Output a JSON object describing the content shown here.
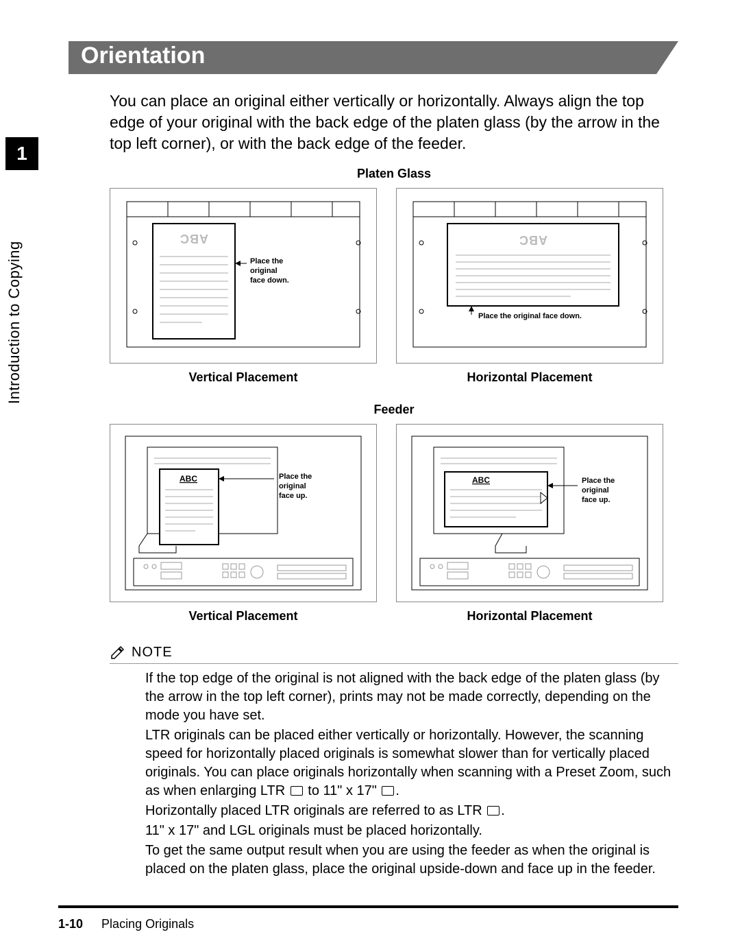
{
  "sidebar": {
    "chapter_number": "1",
    "chapter_label": "Introduction to Copying"
  },
  "heading": "Orientation",
  "intro_text": "You can place an original either vertically or horizontally. Always align the top edge of your original with the back edge of the platen glass (by the arrow in the top left corner), or with the back edge of the feeder.",
  "figures": {
    "platen": {
      "title": "Platen Glass",
      "vertical": {
        "caption": "Vertical Placement",
        "instruction": "Place the original face down.",
        "doc_text": "ABC"
      },
      "horizontal": {
        "caption": "Horizontal Placement",
        "instruction": "Place the original face down.",
        "doc_text": "ABC"
      }
    },
    "feeder": {
      "title": "Feeder",
      "vertical": {
        "caption": "Vertical Placement",
        "instruction": "Place the original face up.",
        "doc_text": "ABC"
      },
      "horizontal": {
        "caption": "Horizontal Placement",
        "instruction": "Place the original face up.",
        "doc_text": "ABC"
      }
    }
  },
  "note": {
    "heading": "NOTE",
    "paragraphs": [
      "If the top edge of the original is not aligned with the back edge of the platen glass (by the arrow in the top left corner), prints may not be made correctly, depending on the mode you have set.",
      "LTR originals can be placed either vertically or horizontally. However, the scanning speed for horizontally placed originals is somewhat slower than for vertically placed originals. You can place originals horizontally when scanning with a Preset Zoom, such as when enlarging LTR ⌷ to 11\" x 17\" ⌷.",
      "Horizontally placed LTR originals are referred to as LTR ⌷.",
      "11\" x 17\" and LGL originals must be placed horizontally.",
      "To get the same output result when you are using the feeder as when the original is placed on the platen glass, place the original upside-down and face up in the feeder."
    ]
  },
  "footer": {
    "page_number": "1-10",
    "section_name": "Placing Originals"
  }
}
